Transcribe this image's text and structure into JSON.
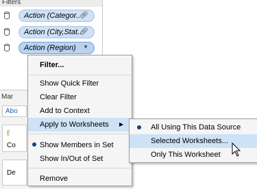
{
  "filters": {
    "title": "Filters",
    "pills": [
      {
        "label": "Action (Categor..",
        "icon": "link-icon"
      },
      {
        "label": "Action (City,Stat..",
        "icon": "link-icon"
      },
      {
        "label": "Action (Region)",
        "icon": "chevron-down-icon"
      }
    ]
  },
  "marks": {
    "title": "Mar",
    "tab": "Abo",
    "card1": "Co",
    "card2": "De"
  },
  "context_menu": {
    "items": [
      {
        "label": "Filter..."
      },
      {
        "label": "Show Quick Filter"
      },
      {
        "label": "Clear Filter"
      },
      {
        "label": "Add to Context"
      },
      {
        "label": "Apply to Worksheets",
        "arrow": "▶"
      },
      {
        "label": "Show Members in Set"
      },
      {
        "label": "Show In/Out of Set"
      },
      {
        "label": "Remove"
      }
    ]
  },
  "submenu": {
    "items": [
      {
        "label": "All Using This Data Source"
      },
      {
        "label": "Selected Worksheets..."
      },
      {
        "label": "Only This Worksheet"
      }
    ]
  },
  "colors": {
    "highlight": "#cde2f7",
    "pill_fill": "#cfe1f5",
    "bullet": "#1a3e87"
  }
}
